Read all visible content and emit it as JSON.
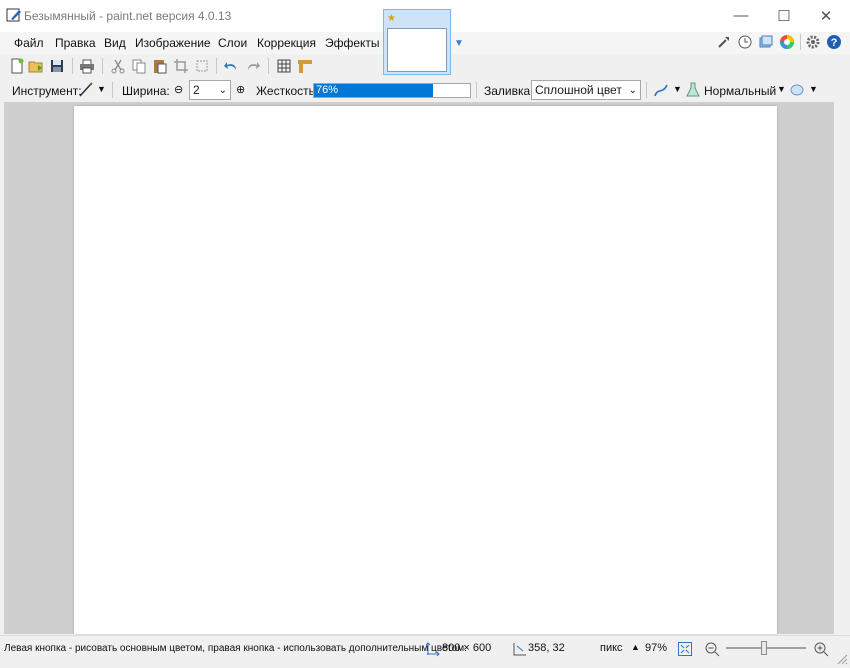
{
  "window": {
    "title": "Безымянный - paint.net версия 4.0.13",
    "minimize": "—",
    "maximize": "☐",
    "close": "✕"
  },
  "menu": [
    "Файл",
    "Правка",
    "Вид",
    "Изображение",
    "Слои",
    "Коррекция",
    "Эффекты"
  ],
  "toolbar_icons": [
    "new-icon",
    "open-icon",
    "save-icon",
    "print-icon",
    "cut-icon",
    "copy-icon",
    "paste-icon",
    "crop-icon",
    "deselect-icon",
    "undo-icon",
    "redo-icon",
    "grid-icon",
    "ruler-icon"
  ],
  "right_icons": [
    "tools-icon",
    "history-icon",
    "layers-icon",
    "colors-icon",
    "settings-icon",
    "help-icon"
  ],
  "options": {
    "tool_label": "Инструмент:",
    "width_label": "Ширина:",
    "width_value": "2",
    "hardness_label": "Жесткость:",
    "hardness_value": "76%",
    "hardness_fraction": 0.76,
    "fill_label": "Заливка:",
    "fill_value": "Сплошной цвет",
    "blend_value": "Нормальный"
  },
  "status": {
    "hint": "Левая кнопка - рисовать основным цветом, правая кнопка - использовать дополнительным цветом.",
    "image_size": "800 × 600",
    "cursor_pos": "358, 32",
    "units": "пикс",
    "zoom": "97%"
  },
  "colors": {
    "accent": "#0078d7",
    "help": "#1e5fb4"
  }
}
